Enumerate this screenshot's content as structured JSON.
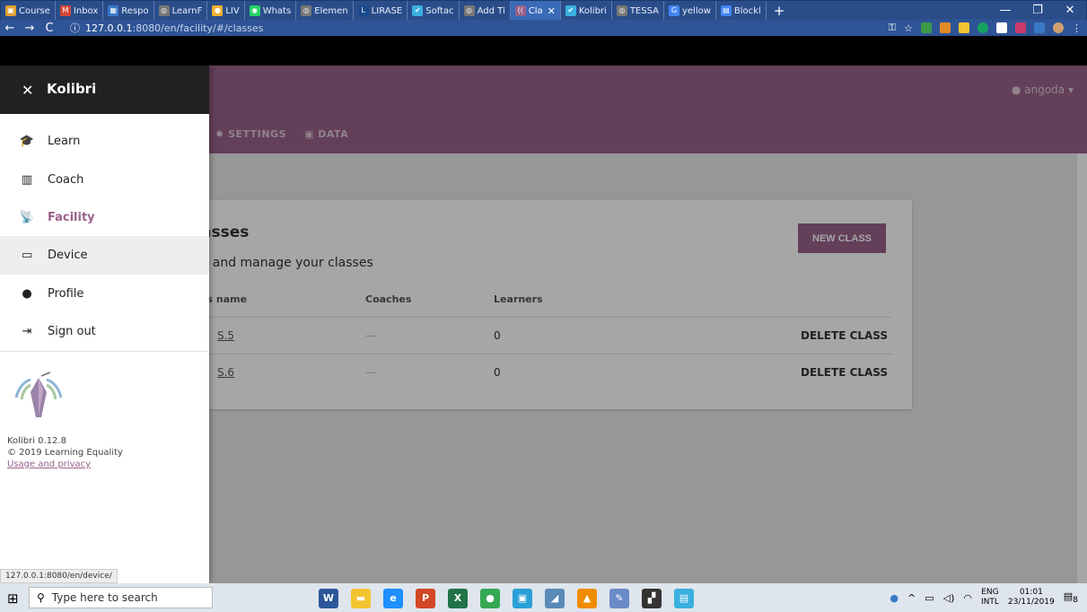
{
  "browser": {
    "tabs": [
      {
        "label": "Course",
        "color": "#e0a030",
        "glyph": "▣"
      },
      {
        "label": "Inbox",
        "color": "#d44638",
        "glyph": "M"
      },
      {
        "label": "Respo",
        "color": "#3a78c8",
        "glyph": "▦"
      },
      {
        "label": "LearnF",
        "color": "#777777",
        "glyph": "◎"
      },
      {
        "label": "LIV",
        "color": "#f0b030",
        "glyph": "●"
      },
      {
        "label": "Whats",
        "color": "#25d366",
        "glyph": "◉"
      },
      {
        "label": "Elemen",
        "color": "#777777",
        "glyph": "◎"
      },
      {
        "label": "LIRASE",
        "color": "#1a4a8a",
        "glyph": "L"
      },
      {
        "label": "Softac",
        "color": "#3ab0e0",
        "glyph": "✔"
      },
      {
        "label": "Add Ti",
        "color": "#777777",
        "glyph": "◎"
      },
      {
        "label": "Cla",
        "color": "#996189",
        "glyph": "((",
        "active": true
      },
      {
        "label": "Kolibri",
        "color": "#3ab0e0",
        "glyph": "✔"
      },
      {
        "label": "TESSA",
        "color": "#777777",
        "glyph": "◎"
      },
      {
        "label": "yellow",
        "color": "#4285f4",
        "glyph": "G"
      },
      {
        "label": "Blockl",
        "color": "#4285f4",
        "glyph": "▤"
      }
    ],
    "tab_close": "✕",
    "new_tab": "+",
    "window_controls": {
      "minimize": "—",
      "maximize": "❐",
      "close": "✕"
    },
    "nav": {
      "back": "←",
      "forward": "→",
      "reload": "C"
    },
    "url": {
      "info": "ⓘ",
      "host": "127.0.0.1",
      "path": ":8080/en/facility/#/classes"
    },
    "toolbar_icons": {
      "key": "⚿",
      "star": "☆",
      "menu": "⋮"
    },
    "status_url": "127.0.0.1:8080/en/device/"
  },
  "app": {
    "user": "angoda",
    "user_icon": "●",
    "caret": "▾",
    "tabs": [
      {
        "label": "SETTINGS",
        "icon": "✹"
      },
      {
        "label": "DATA",
        "icon": "▣"
      }
    ],
    "accent": "#996189",
    "page": {
      "title": "asses",
      "description": "v and manage your classes",
      "new_class": "NEW CLASS",
      "columns": [
        "ss name",
        "Coaches",
        "Learners"
      ],
      "rows": [
        {
          "name": "S.5",
          "coaches": "—",
          "learners": "0",
          "action": "DELETE CLASS"
        },
        {
          "name": "S.6",
          "coaches": "—",
          "learners": "0",
          "action": "DELETE CLASS"
        }
      ]
    }
  },
  "drawer": {
    "close": "✕",
    "title": "Kolibri",
    "items": [
      {
        "label": "Learn",
        "icon": "🎓"
      },
      {
        "label": "Coach",
        "icon": "▥"
      },
      {
        "label": "Facility",
        "icon": "📡"
      },
      {
        "label": "Device",
        "icon": "▭"
      },
      {
        "label": "Profile",
        "icon": "●"
      },
      {
        "label": "Sign out",
        "icon": "⇥"
      }
    ],
    "version": "Kolibri 0.12.8",
    "copyright": "© 2019 Learning Equality",
    "privacy": "Usage and privacy"
  },
  "taskbar": {
    "start": "⊞",
    "search_icon": "⚲",
    "search_placeholder": "Type here to search",
    "apps": [
      {
        "glyph": "W",
        "color": "#2b579a"
      },
      {
        "glyph": "▬",
        "color": "#f4c430"
      },
      {
        "glyph": "e",
        "color": "#1e90ff"
      },
      {
        "glyph": "P",
        "color": "#d24726"
      },
      {
        "glyph": "X",
        "color": "#217346"
      },
      {
        "glyph": "●",
        "color": "#34a853"
      },
      {
        "glyph": "▣",
        "color": "#2aa0d8"
      },
      {
        "glyph": "◢",
        "color": "#5a8ab8"
      },
      {
        "glyph": "▲",
        "color": "#f08c00"
      },
      {
        "glyph": "✎",
        "color": "#6a8ac8"
      },
      {
        "glyph": "▞",
        "color": "#333333"
      },
      {
        "glyph": "▤",
        "color": "#3ab0e0"
      }
    ],
    "lang_top": "ENG",
    "lang_bottom": "INTL",
    "time": "01:01",
    "date": "23/11/2019",
    "notifications": "8"
  }
}
